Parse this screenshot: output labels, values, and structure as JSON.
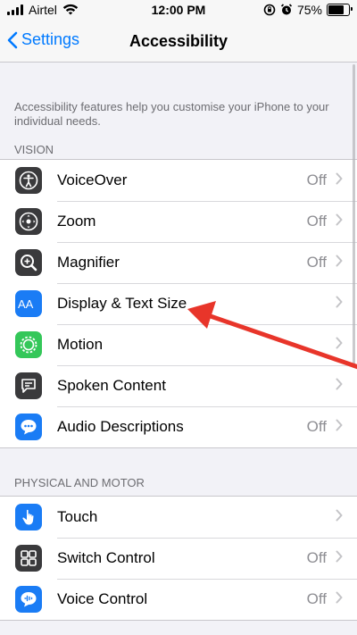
{
  "status_bar": {
    "carrier": "Airtel",
    "time": "12:00 PM",
    "battery": "75%",
    "battery_level": 0.75
  },
  "nav": {
    "back_label": "Settings",
    "title": "Accessibility"
  },
  "description": "Accessibility features help you customise your iPhone to your individual needs.",
  "sections": [
    {
      "header": "VISION",
      "items": [
        {
          "label": "VoiceOver",
          "value": "Off",
          "icon": "voiceover-icon",
          "color": "#3a3a3c"
        },
        {
          "label": "Zoom",
          "value": "Off",
          "icon": "zoom-icon",
          "color": "#3a3a3c"
        },
        {
          "label": "Magnifier",
          "value": "Off",
          "icon": "magnifier-icon",
          "color": "#3a3a3c"
        },
        {
          "label": "Display & Text Size",
          "value": "",
          "icon": "text-size-icon",
          "color": "#1a7cf5"
        },
        {
          "label": "Motion",
          "value": "",
          "icon": "motion-icon",
          "color": "#34c759"
        },
        {
          "label": "Spoken Content",
          "value": "",
          "icon": "spoken-content-icon",
          "color": "#3a3a3c"
        },
        {
          "label": "Audio Descriptions",
          "value": "Off",
          "icon": "audio-descriptions-icon",
          "color": "#1a7cf5"
        }
      ]
    },
    {
      "header": "PHYSICAL AND MOTOR",
      "items": [
        {
          "label": "Touch",
          "value": "",
          "icon": "touch-icon",
          "color": "#1a7cf5"
        },
        {
          "label": "Switch Control",
          "value": "Off",
          "icon": "switch-control-icon",
          "color": "#3a3a3c"
        },
        {
          "label": "Voice Control",
          "value": "Off",
          "icon": "voice-control-icon",
          "color": "#1a7cf5"
        }
      ]
    }
  ],
  "annotation": {
    "color": "#e8352a",
    "points_to": "Display & Text Size"
  }
}
